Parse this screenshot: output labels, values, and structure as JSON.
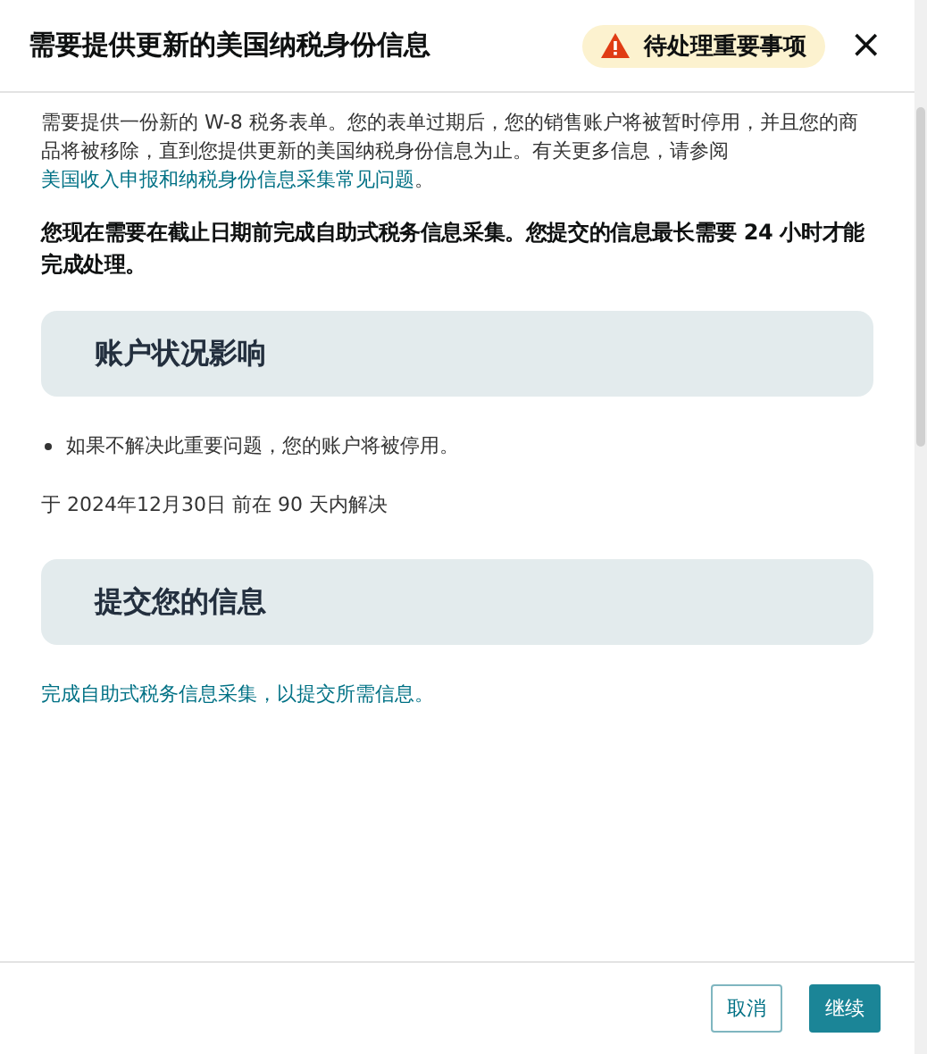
{
  "dialog": {
    "title": "需要提供更新的美国纳税身份信息",
    "badge": {
      "label": "待处理重要事项"
    },
    "close": "×"
  },
  "intro": {
    "text": "需要提供一份新的 W-8 税务表单。您的表单过期后，您的销售账户将被暂时停用，并且您的商品将被移除，直到您提供更新的美国纳税身份信息为止。有关更多信息，请参阅",
    "link": "美国收入申报和纳税身份信息采集常见问题",
    "end": "。"
  },
  "notice": "您现在需要在截止日期前完成自助式税务信息采集。您提交的信息最长需要 24 小时才能完成处理。",
  "sections": [
    {
      "heading": "账户状况影响",
      "items": [
        {
          "kind": "bullet",
          "text": "如果不解决此重要问题，您的账户将被停用。"
        },
        {
          "kind": "text",
          "text": "于 2024年12月30日 前在 90 天内解决"
        }
      ]
    },
    {
      "heading": "提交您的信息",
      "items": [
        {
          "kind": "link",
          "text": "完成自助式税务信息采集，以提交所需信息。"
        }
      ]
    }
  ],
  "buttons": [
    {
      "label": "取消",
      "kind": "secondary"
    },
    {
      "label": "继续",
      "kind": "primary"
    }
  ]
}
